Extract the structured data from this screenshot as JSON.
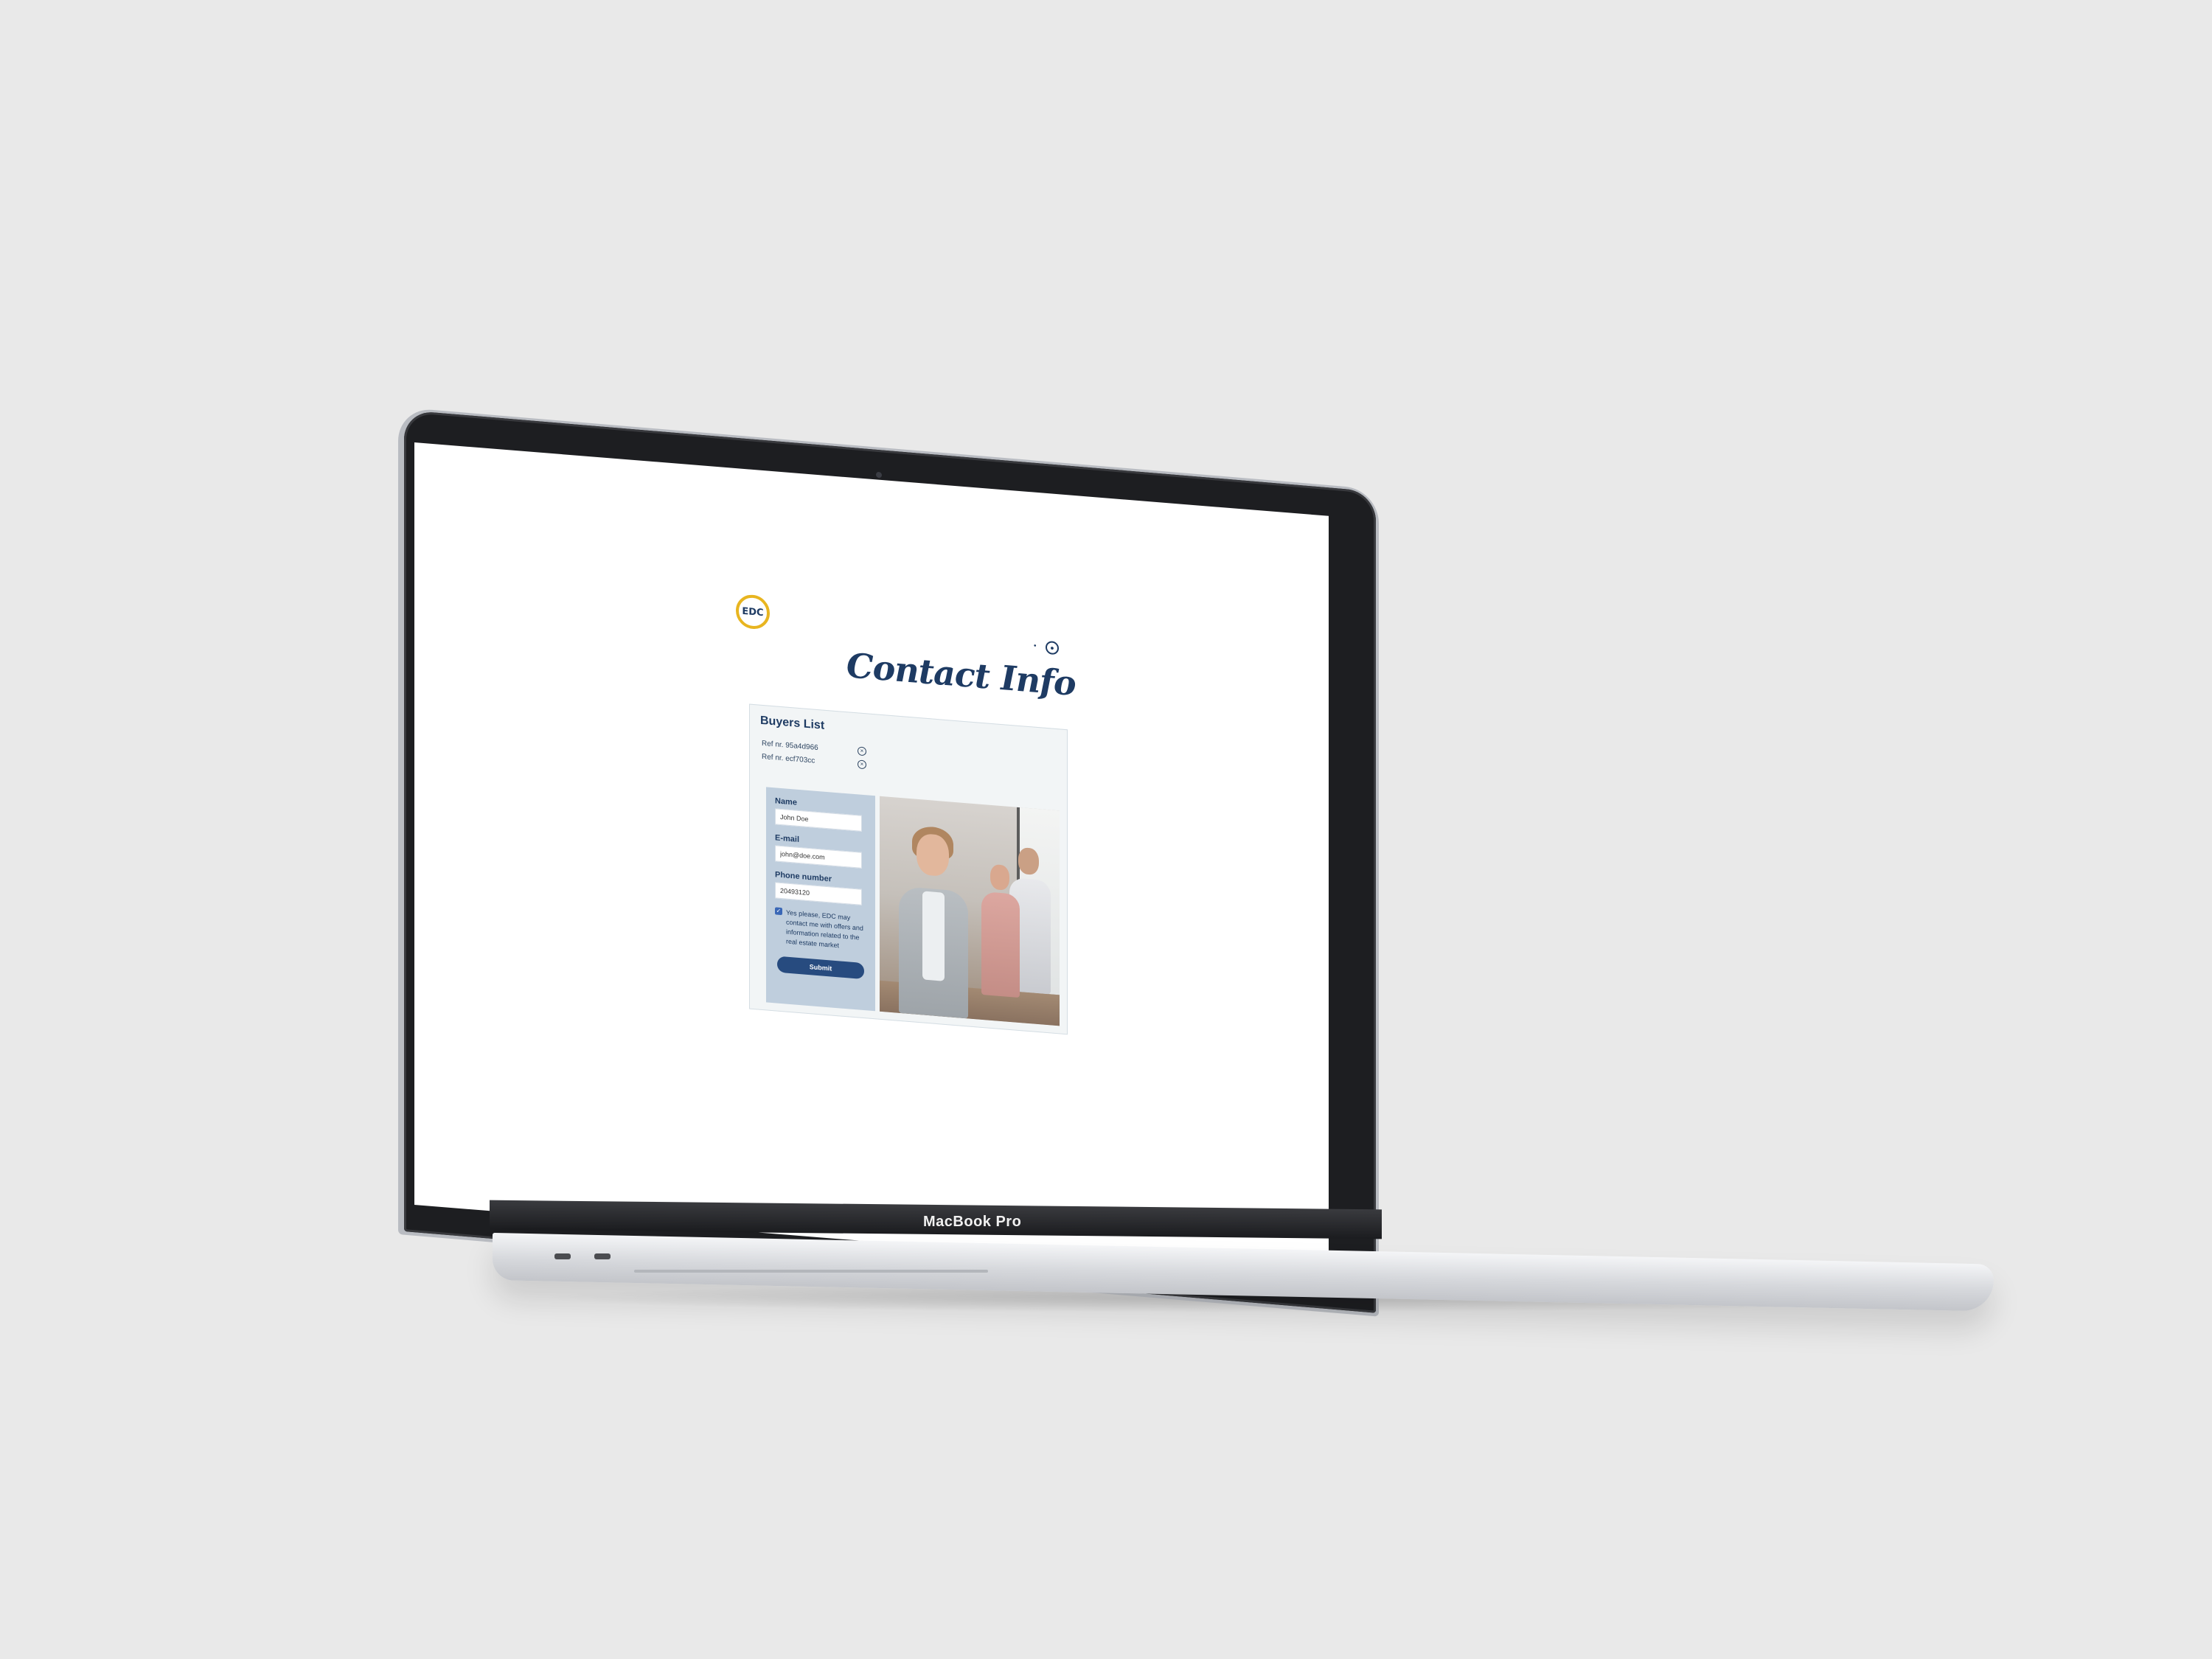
{
  "device": {
    "brand_label": "MacBook Pro"
  },
  "site": {
    "logo": {
      "text": "EDC",
      "color": "#1e3b63",
      "ring_color": "#e8b520",
      "icon": "edc-logo"
    },
    "header_icons": [
      "notification-icon",
      "user-icon"
    ],
    "page_title": "Contact Info"
  },
  "buyers": {
    "title": "Buyers List",
    "items": [
      {
        "ref": "Ref nr. 95a4d966"
      },
      {
        "ref": "Ref nr. ecf703cc"
      }
    ]
  },
  "form": {
    "name_label": "Name",
    "name_value": "John Doe",
    "email_label": "E-mail",
    "email_value": "john@doe.com",
    "phone_label": "Phone number",
    "phone_value": "20493120",
    "consent_checked": true,
    "consent_text": "Yes please, EDC may contact me with offers and information related to the real estate market",
    "submit_label": "Submit"
  },
  "colors": {
    "primary": "#1e3b63",
    "button": "#274b7f",
    "panel": "#bfcedd",
    "card": "#f2f5f6"
  }
}
